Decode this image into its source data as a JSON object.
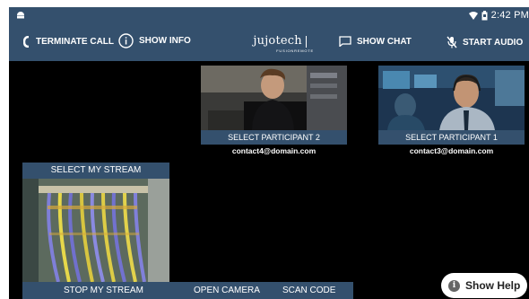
{
  "status": {
    "time": "2:42 PM"
  },
  "toolbar": {
    "terminate": "TERMINATE CALL",
    "info": "SHOW INFO",
    "logo_name": "jujotech",
    "logo_sub": "FUSIONREMOTE",
    "chat": "SHOW CHAT",
    "audio": "START AUDIO"
  },
  "participants": [
    {
      "label": "SELECT PARTICIPANT 2",
      "email": "contact4@domain.com"
    },
    {
      "label": "SELECT PARTICIPANT 1",
      "email": "contact3@domain.com"
    }
  ],
  "my_stream": {
    "select": "SELECT MY STREAM",
    "stop": "STOP MY STREAM",
    "open_camera": "OPEN CAMERA",
    "scan_code": "SCAN CODE"
  },
  "help": {
    "label": "Show Help"
  }
}
